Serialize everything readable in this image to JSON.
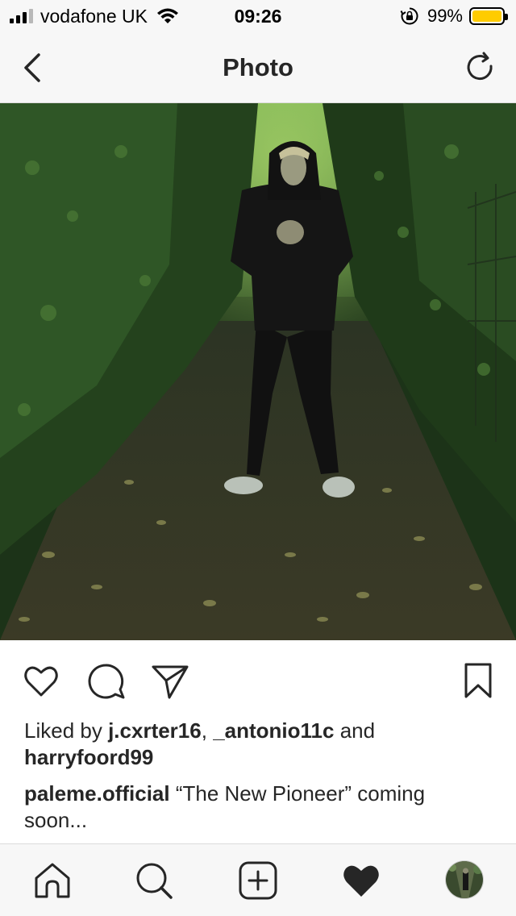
{
  "status_bar": {
    "carrier": "vodafone UK",
    "time": "09:26",
    "battery_pct": "99%",
    "battery_level": 0.99,
    "signal_bars_active": 3,
    "signal_bars_total": 4,
    "battery_color": "#ffcc00"
  },
  "nav": {
    "title": "Photo",
    "back_icon": "chevron-left-icon",
    "refresh_icon": "refresh-icon"
  },
  "post": {
    "photo_description_icon": "photo",
    "actions": [
      "heart-icon",
      "comment-icon",
      "share-icon",
      "bookmark-icon"
    ],
    "likes_prefix": "Liked by ",
    "liked_user_1": "j.cxrter16",
    "likes_sep": ", ",
    "liked_user_2": "_antonio11c",
    "likes_and": " and",
    "liked_user_3": "harryfoord99",
    "caption_user": "paleme.official",
    "caption_text": " “The New Pioneer” coming soon..."
  },
  "tab_bar": {
    "tabs": [
      "home-icon",
      "search-icon",
      "add-post-icon",
      "activity-heart-icon",
      "profile-avatar"
    ]
  }
}
